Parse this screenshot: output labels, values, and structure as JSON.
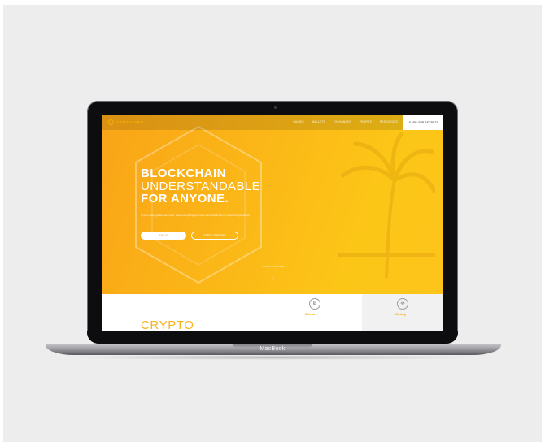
{
  "site": {
    "logo_text": "SANDYLAND",
    "nav": [
      "GUIDES",
      "WALLETS",
      "EXCHANGES",
      "PROFITS",
      "RESOURCES"
    ],
    "cta": "LEARN OUR SECRETS"
  },
  "hero": {
    "title_line1": "BLOCKCHAIN",
    "title_line2": "UNDERSTANDABLE",
    "title_line3": "FOR ANYONE.",
    "subtitle": "Crypto news, guides, and tools. Learn everything you need about blockchain to invest and get ahead.",
    "primary_button": "JOIN US",
    "secondary_button": "START LEARNING",
    "scroll_hint": "SCROLL TO EXPLORE"
  },
  "section": {
    "heading": "CRYPTO",
    "features": [
      {
        "label": "Bitcoin +",
        "icon": "bitcoin-icon",
        "glyph": "Ƀ"
      },
      {
        "label": "Mining +",
        "icon": "mining-icon",
        "glyph": "⚒"
      }
    ]
  },
  "device": {
    "brand_label": "MacBook"
  },
  "colors": {
    "accent": "#f9b21b",
    "hero_start": "#f9a417",
    "hero_end": "#fdc41a"
  }
}
